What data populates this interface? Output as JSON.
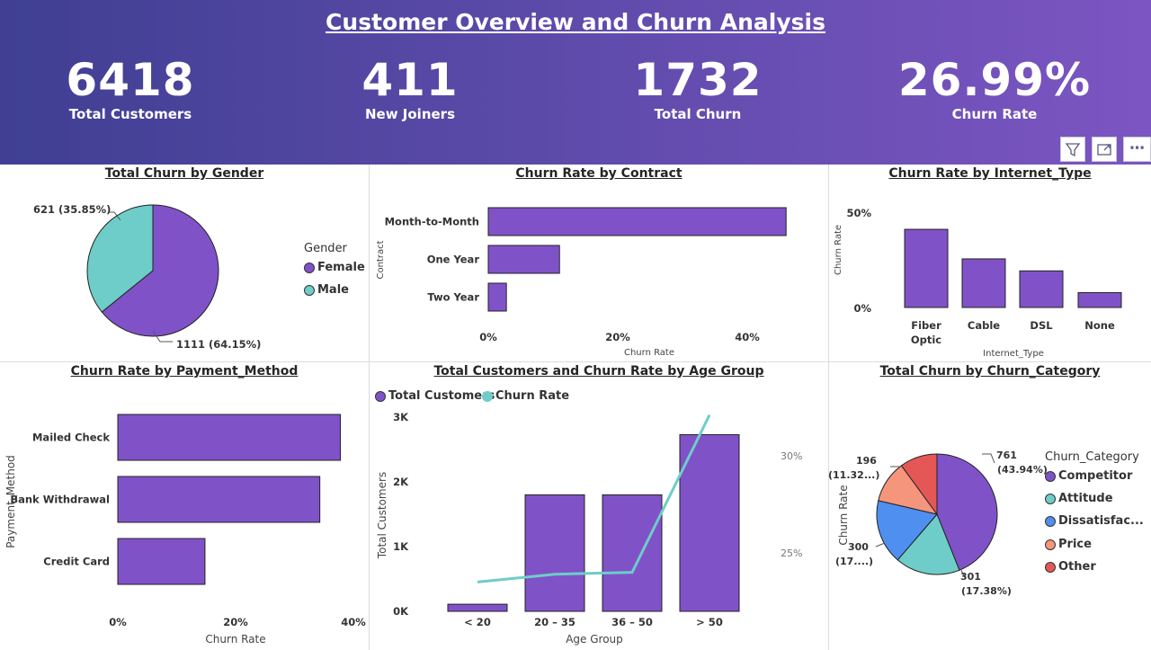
{
  "header": {
    "title": "Customer Overview and Churn Analysis"
  },
  "kpis": [
    {
      "value": "6418",
      "label": "Total Customers"
    },
    {
      "value": "411",
      "label": "New Joiners"
    },
    {
      "value": "1732",
      "label": "Total Churn"
    },
    {
      "value": "26.99%",
      "label": "Churn Rate"
    }
  ],
  "toolbar": {
    "filter": "filter-icon",
    "focus": "focus-mode-icon",
    "more": "⋯"
  },
  "colors": {
    "purple": "#8052c8",
    "teal": "#6ecdc8",
    "blue": "#4f8ff0",
    "salmon": "#f4957c",
    "red": "#e45757",
    "header_start": "#3f3f93",
    "header_end": "#7c55c2"
  },
  "gender": {
    "title": "Total Churn by Gender",
    "legend_title": "Gender",
    "slices": [
      {
        "name": "Female",
        "value": 1111,
        "label": "1111 (64.15%)"
      },
      {
        "name": "Male",
        "value": 621,
        "label": "621 (35.85%)"
      }
    ]
  },
  "contract": {
    "title": "Churn Rate by Contract",
    "ylabel": "Contract",
    "xlabel": "Churn Rate",
    "ticks": [
      "0%",
      "20%",
      "40%"
    ]
  },
  "internet": {
    "title": "Churn Rate by Internet_Type",
    "ylabel": "Churn Rate",
    "xlabel": "Internet_Type",
    "ticks": [
      "50%",
      "0%"
    ],
    "cat1a": "Fiber",
    "cat1b": "Optic"
  },
  "payment": {
    "title": "Churn Rate by Payment_Method",
    "ylabel": "Payment_Method",
    "xlabel": "Churn Rate",
    "ticks": [
      "0%",
      "20%",
      "40%"
    ]
  },
  "age": {
    "title": "Total Customers and Churn Rate by Age Group",
    "legend": [
      "Total Customers",
      "Churn Rate"
    ],
    "ylabel_left": "Total Customers",
    "ylabel_right": "Churn Rate",
    "xlabel": "Age Group",
    "left_ticks": [
      "3K",
      "2K",
      "1K",
      "0K"
    ],
    "right_ticks": [
      "30%",
      "25%"
    ]
  },
  "category": {
    "title": "Total Churn by Churn_Category",
    "legend_title": "Churn_Category",
    "ylabel": "Churn Rate",
    "legend": [
      "Competitor",
      "Attitude",
      "Dissatisfac...",
      "Price",
      "Other"
    ],
    "labels": {
      "competitor_a": "761",
      "competitor_b": "(43.94%)",
      "attitude_a": "301",
      "attitude_b": "(17.38%)",
      "dissat_a": "300",
      "dissat_b": "(17....)",
      "price_a": "196",
      "price_b": "(11.32...)"
    }
  },
  "chart_data": [
    {
      "type": "pie",
      "title": "Total Churn by Gender",
      "categories": [
        "Female",
        "Male"
      ],
      "values": [
        1111,
        621
      ]
    },
    {
      "type": "bar",
      "orientation": "horizontal",
      "title": "Churn Rate by Contract",
      "xlabel": "Churn Rate",
      "ylabel": "Contract",
      "categories": [
        "Month-to-Month",
        "One Year",
        "Two Year"
      ],
      "values": [
        46,
        11,
        2.8
      ],
      "xlim": [
        0,
        48
      ]
    },
    {
      "type": "bar",
      "title": "Churn Rate by Internet_Type",
      "xlabel": "Internet_Type",
      "ylabel": "Churn Rate",
      "categories": [
        "Fiber Optic",
        "Cable",
        "DSL",
        "None"
      ],
      "values": [
        41,
        25.5,
        19.2,
        7.8
      ],
      "ylim": [
        0,
        50
      ]
    },
    {
      "type": "bar",
      "orientation": "horizontal",
      "title": "Churn Rate by Payment_Method",
      "xlabel": "Churn Rate",
      "ylabel": "Payment_Method",
      "categories": [
        "Mailed Check",
        "Bank Withdrawal",
        "Credit Card"
      ],
      "values": [
        37.8,
        34.3,
        14.8
      ],
      "xlim": [
        0,
        40
      ]
    },
    {
      "type": "bar",
      "title": "Total Customers and Churn Rate by Age Group",
      "xlabel": "Age Group",
      "ylabel": "Total Customers",
      "categories": [
        "< 20",
        "20 – 35",
        "36 – 50",
        "> 50"
      ],
      "series": [
        {
          "name": "Total Customers",
          "values": [
            110,
            1800,
            1800,
            2730
          ]
        },
        {
          "name": "Churn Rate",
          "values": [
            23.5,
            23.9,
            24.0,
            32.1
          ]
        }
      ],
      "ylim": [
        0,
        3000
      ]
    },
    {
      "type": "pie",
      "title": "Total Churn by Churn_Category",
      "categories": [
        "Competitor",
        "Attitude",
        "Dissatisfac...",
        "Price",
        "Other"
      ],
      "values": [
        761,
        301,
        300,
        196,
        174
      ]
    }
  ]
}
